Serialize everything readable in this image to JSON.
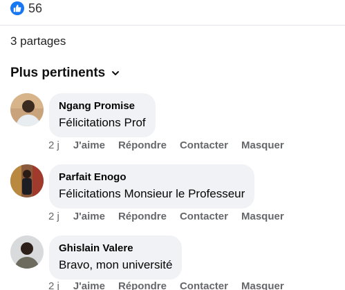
{
  "reactions": {
    "count": "56",
    "icon": "thumbs-up-icon",
    "color": "#1877f2"
  },
  "shares": {
    "label": "3 partages"
  },
  "sort": {
    "label": "Plus pertinents",
    "icon": "chevron-down-icon"
  },
  "comments": [
    {
      "author": "Ngang Promise",
      "text": "Félicitations Prof",
      "time": "2 j"
    },
    {
      "author": "Parfait Enogo",
      "text": "Félicitations Monsieur le Professeur",
      "time": "2 j"
    },
    {
      "author": "Ghislain Valere",
      "text": "Bravo, mon université",
      "time": "2 j"
    }
  ],
  "actions": {
    "like": "J'aime",
    "reply": "Répondre",
    "contact": "Contacter",
    "hide": "Masquer"
  }
}
